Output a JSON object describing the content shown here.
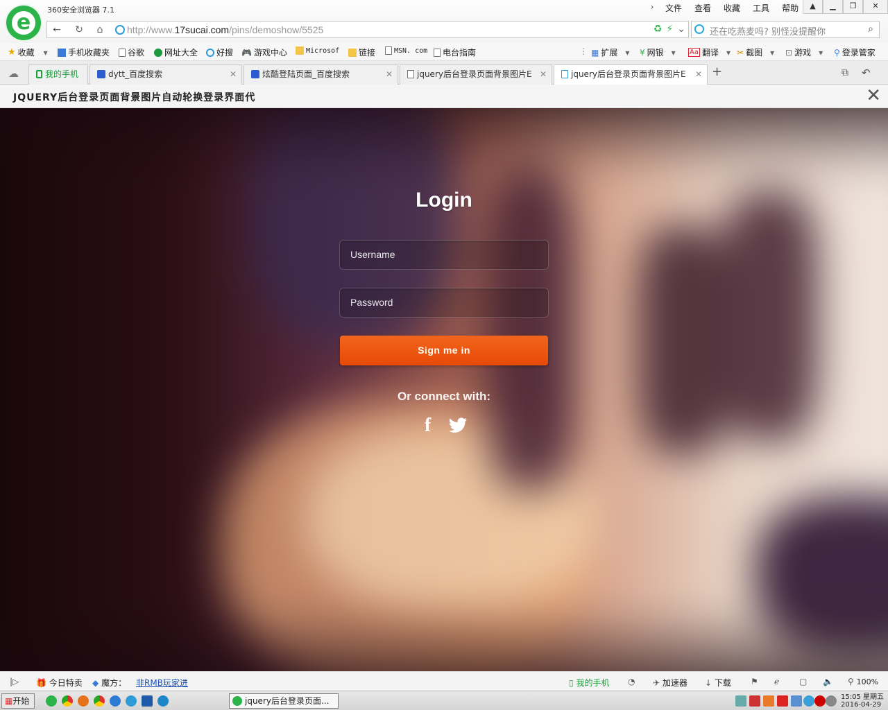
{
  "app": {
    "title": "360安全浏览器 7.1"
  },
  "menu": {
    "items": [
      "文件",
      "查看",
      "收藏",
      "工具",
      "帮助"
    ]
  },
  "address": {
    "url_prefix": "http://www.",
    "url_domain": "17sucai.com",
    "url_path": "/pins/demoshow/5525"
  },
  "search": {
    "placeholder": "还在吃燕麦吗? 别怪没提醒你"
  },
  "bookmarks": {
    "left": [
      "收藏",
      "手机收藏夹",
      "谷歌",
      "网址大全",
      "好搜",
      "游戏中心",
      "Microsof",
      "链接",
      "MSN. com",
      "电台指南"
    ],
    "right": [
      "扩展",
      "网银",
      "翻译",
      "截图",
      "游戏",
      "登录管家"
    ]
  },
  "tabs": [
    {
      "label": "我的手机"
    },
    {
      "label": "dytt_百度搜索"
    },
    {
      "label": "炫酷登陆页面_百度搜索"
    },
    {
      "label": "jquery后台登录页面背景图片E"
    },
    {
      "label": "jquery后台登录页面背景图片E"
    }
  ],
  "page": {
    "header_title": "JQUERY后台登录页面背景图片自动轮换登录界面代"
  },
  "login": {
    "title": "Login",
    "username_placeholder": "Username",
    "password_placeholder": "Password",
    "submit_label": "Sign me in",
    "connect_label": "Or connect with:",
    "facebook_glyph": "f"
  },
  "statusbar": {
    "deal": "今日特卖",
    "magic": "魔方：",
    "magic_link": "非RMB玩家进",
    "phone": "我的手机",
    "accelerator": "加速器",
    "download": "下载",
    "zoom": "100%"
  },
  "taskbar": {
    "start": "开始",
    "task": "jquery后台登录页面...",
    "time": "15:05",
    "weekday": "星期五",
    "date": "2016-04-29"
  }
}
